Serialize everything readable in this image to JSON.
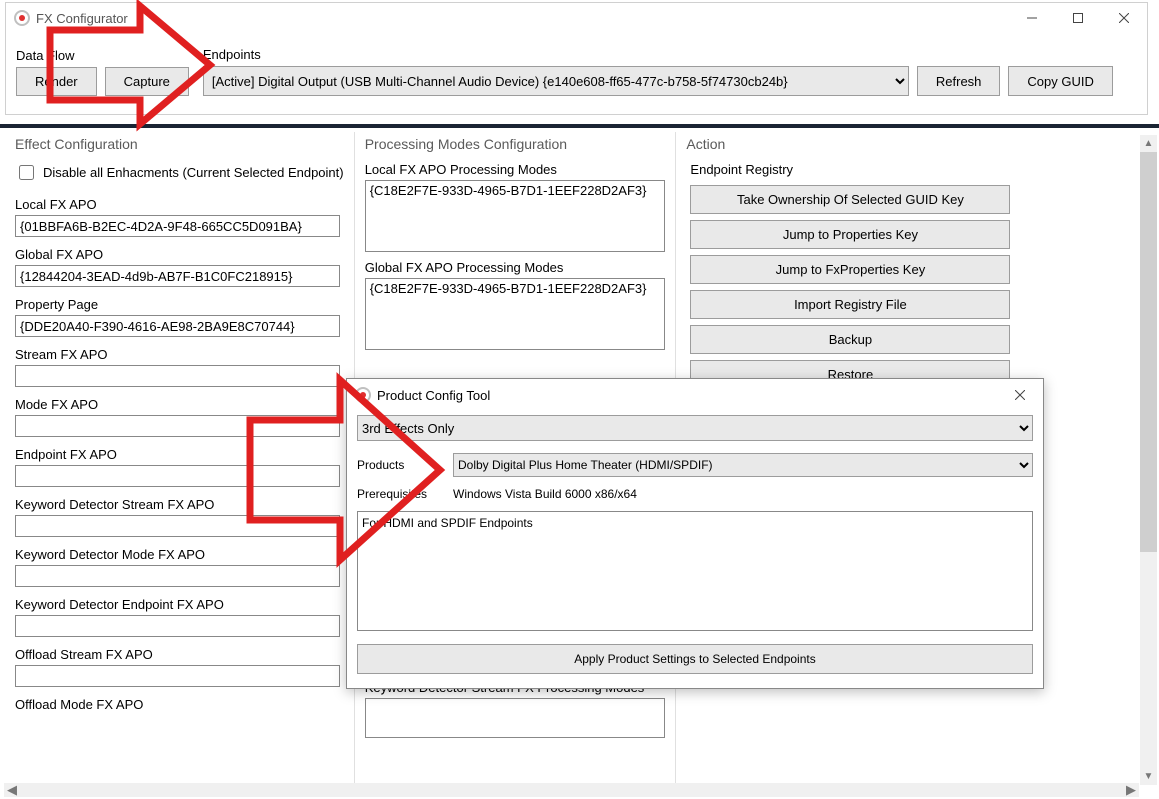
{
  "mainWindow": {
    "title": "FX Configurator",
    "dataFlow": {
      "label": "Data Flow",
      "renderBtn": "Render",
      "captureBtn": "Capture"
    },
    "endpoints": {
      "label": "Endpoints",
      "selected": "[Active] Digital Output (USB Multi-Channel Audio Device) {e140e608-ff65-477c-b758-5f74730cb24b}",
      "refreshBtn": "Refresh",
      "copyGuidBtn": "Copy GUID"
    }
  },
  "effectConfig": {
    "heading": "Effect Configuration",
    "disableAll": "Disable all Enhacments (Current Selected Endpoint)",
    "fields": {
      "localFxApo": {
        "label": "Local FX APO",
        "value": "{01BBFA6B-B2EC-4D2A-9F48-665CC5D091BA}"
      },
      "globalFxApo": {
        "label": "Global FX APO",
        "value": "{12844204-3EAD-4d9b-AB7F-B1C0FC218915}"
      },
      "propPage": {
        "label": "Property Page",
        "value": "{DDE20A40-F390-4616-AE98-2BA9E8C70744}"
      },
      "streamFxApo": {
        "label": "Stream FX APO",
        "value": ""
      },
      "modeFxApo": {
        "label": "Mode FX APO",
        "value": ""
      },
      "endpointFxApo": {
        "label": "Endpoint FX APO",
        "value": ""
      },
      "kwdStream": {
        "label": "Keyword Detector Stream FX APO",
        "value": ""
      },
      "kwdMode": {
        "label": "Keyword Detector Mode FX APO",
        "value": ""
      },
      "kwdEndpoint": {
        "label": "Keyword Detector Endpoint FX APO",
        "value": ""
      },
      "offloadStream": {
        "label": "Offload Stream FX APO",
        "value": ""
      },
      "offloadMode": {
        "label": "Offload Mode FX APO",
        "value": ""
      }
    }
  },
  "procModes": {
    "heading": "Processing Modes Configuration",
    "local": {
      "label": "Local FX APO Processing Modes",
      "value": "{C18E2F7E-933D-4965-B7D1-1EEF228D2AF3}"
    },
    "global": {
      "label": "Global FX APO Processing Modes",
      "value": "{C18E2F7E-933D-4965-B7D1-1EEF228D2AF3}"
    },
    "kwdStream": {
      "label": "Keyword Detector Stream FX Processing Modes",
      "value": ""
    }
  },
  "action": {
    "heading": "Action",
    "subhead": "Endpoint Registry",
    "buttons": [
      "Take Ownership Of Selected GUID Key",
      "Jump to Properties Key",
      "Jump to FxProperties Key",
      "Import Registry File",
      "Backup",
      "Restore"
    ]
  },
  "modal": {
    "title": "Product Config Tool",
    "modeSelect": "3rd Effects Only",
    "productsLabel": "Products",
    "productSelect": "Dolby Digital Plus Home Theater (HDMI/SPDIF)",
    "prereqLabel": "Prerequisites",
    "prereqValue": "Windows Vista Build 6000 x86/x64",
    "description": "For HDMI and SPDIF Endpoints",
    "applyBtn": "Apply Product Settings to Selected Endpoints"
  }
}
